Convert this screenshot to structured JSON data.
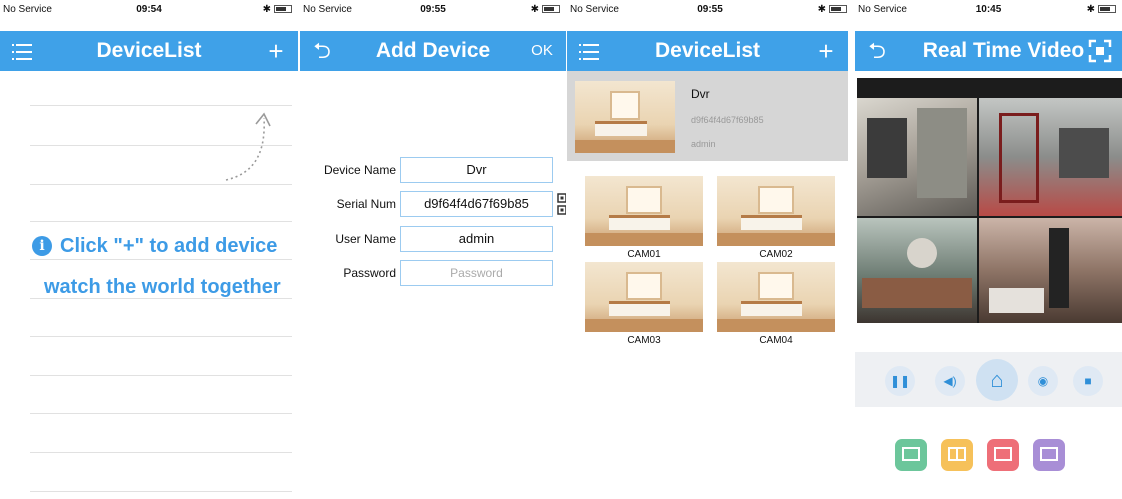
{
  "screen1": {
    "status": {
      "carrier": "No Service",
      "time": "09:54"
    },
    "title": "DeviceList",
    "hint_line1": "Click \"+\" to add device",
    "hint_line2": "watch the world together",
    "icons": {
      "menu": "menu-icon",
      "add": "plus-icon",
      "info": "info-icon",
      "arrow": "dotted-arrow-icon"
    }
  },
  "screen2": {
    "status": {
      "carrier": "No Service",
      "time": "09:55"
    },
    "title": "Add Device",
    "ok_label": "OK",
    "fields": {
      "device_name": {
        "label": "Device Name",
        "value": "Dvr"
      },
      "serial_num": {
        "label": "Serial Num",
        "value": "d9f64f4d67f69b85"
      },
      "user_name": {
        "label": "User Name",
        "value": "admin"
      },
      "password": {
        "label": "Password",
        "placeholder": "Password"
      }
    },
    "icons": {
      "back": "back-icon",
      "qr": "qr-code-icon"
    }
  },
  "screen3": {
    "status": {
      "carrier": "No Service",
      "time": "09:55"
    },
    "title": "DeviceList",
    "device": {
      "name": "Dvr",
      "serial": "d9f64f4d67f69b85",
      "user": "admin"
    },
    "cameras": [
      "CAM01",
      "CAM02",
      "CAM03",
      "CAM04"
    ]
  },
  "screen4": {
    "status": {
      "carrier": "No Service",
      "time": "10:45"
    },
    "title": "Real Time Video",
    "controls": [
      "pause-icon",
      "volume-icon",
      "home-icon",
      "camera-icon",
      "record-icon"
    ],
    "layouts": [
      {
        "name": "layout-1-icon",
        "color": "#6cc69b"
      },
      {
        "name": "layout-4-icon",
        "color": "#f6c15a"
      },
      {
        "name": "layout-9-icon",
        "color": "#ee6f78"
      },
      {
        "name": "layout-16-icon",
        "color": "#a88ed6"
      }
    ]
  },
  "colors": {
    "accent": "#3fa1e8",
    "hint": "#3d9be6"
  }
}
